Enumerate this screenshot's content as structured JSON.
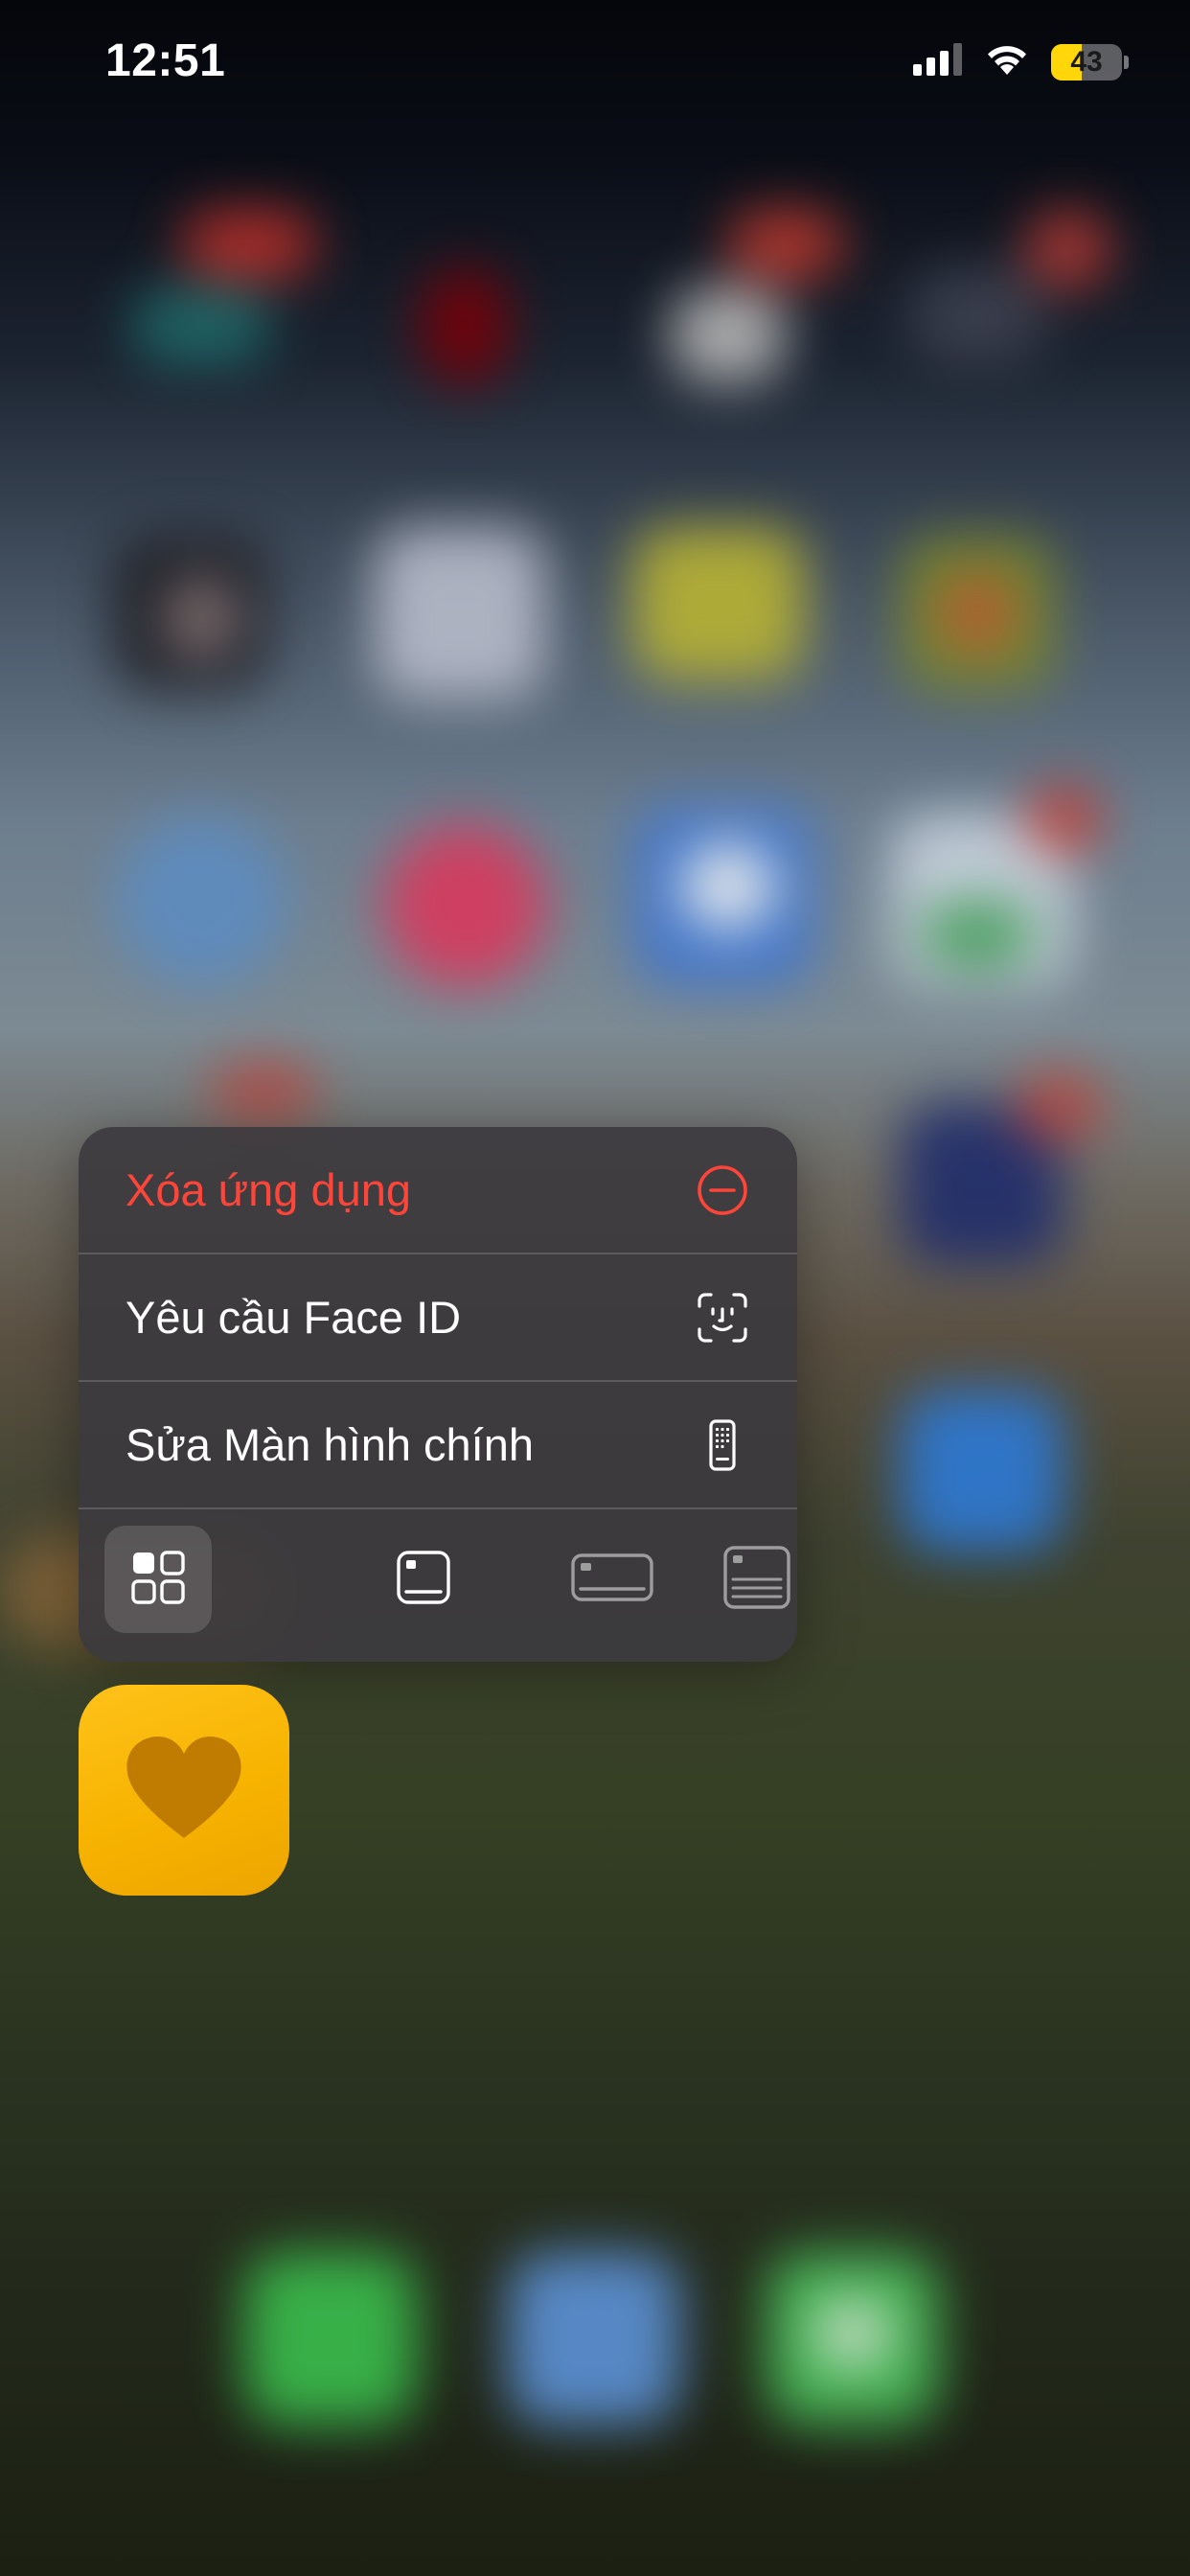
{
  "status_bar": {
    "time": "12:51",
    "battery_percent": "43",
    "battery_level": 0.43,
    "signal_icon": "cellular-signal-icon",
    "wifi_icon": "wifi-icon"
  },
  "context_menu": {
    "items": [
      {
        "label": "Xóa ứng dụng",
        "icon": "minus-circle-icon",
        "destructive": true,
        "color": "#ff453a"
      },
      {
        "label": "Yêu cầu Face ID",
        "icon": "face-id-icon",
        "destructive": false
      },
      {
        "label": "Sửa Màn hình chính",
        "icon": "phone-home-screen-icon",
        "destructive": false
      }
    ],
    "size_options": [
      {
        "icon": "small-widget-grid-icon",
        "selected": true
      },
      {
        "icon": "medium-square-widget-icon",
        "selected": false
      },
      {
        "icon": "wide-widget-icon",
        "selected": false
      },
      {
        "icon": "large-widget-icon",
        "selected": false
      }
    ]
  },
  "app": {
    "icon": "heart-icon",
    "icon_color": "#ffbe0b"
  }
}
